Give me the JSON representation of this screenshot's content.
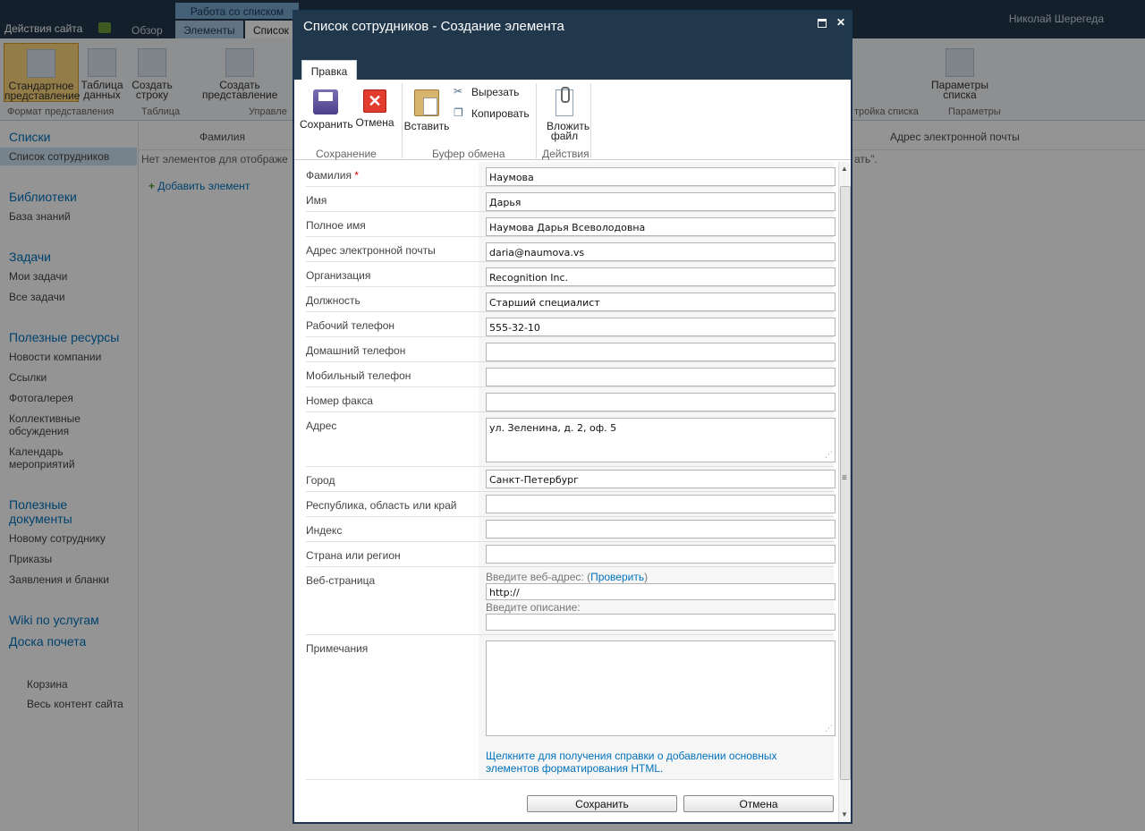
{
  "background": {
    "site_actions": "Действия сайта",
    "tab_overview": "Обзор",
    "context_header": "Работа со списком",
    "tab_elements": "Элементы",
    "tab_list": "Список",
    "user_name": "Николай Шерегеда",
    "ribbon": {
      "standard_view": "Стандартное представление",
      "datasheet": "Таблица данных",
      "create_row": "Создать строку",
      "create_view": "Создать представление",
      "list_params": "Параметры списка",
      "group_format": "Формат представления",
      "group_table": "Таблица",
      "group_manage": "Управле",
      "group_settings": "тройка списка",
      "group_params": "Параметры"
    },
    "nav": {
      "lists": "Списки",
      "employee_list": "Список сотрудников",
      "libraries": "Библиотеки",
      "knowledge_base": "База знаний",
      "tasks": "Задачи",
      "my_tasks": "Мои задачи",
      "all_tasks": "Все задачи",
      "resources": "Полезные ресурсы",
      "news": "Новости компании",
      "links": "Ссылки",
      "gallery": "Фотогалерея",
      "discussions": "Коллективные обсуждения",
      "calendar": "Календарь мероприятий",
      "documents": "Полезные документы",
      "newcomer": "Новому сотруднику",
      "orders": "Приказы",
      "forms": "Заявления и бланки",
      "wiki": "Wiki по услугам",
      "honor": "Доска почета",
      "recycle": "Корзина",
      "all_content": "Весь контент сайта"
    },
    "list_col_lastname": "Фамилия",
    "list_col_email": "Адрес электронной почты",
    "empty_text": "Нет элементов для отображе",
    "empty_tail": "ать\".",
    "add_item": "Добавить элемент"
  },
  "dialog": {
    "title": "Список сотрудников - Создание элемента",
    "tab_edit": "Правка",
    "buttons": {
      "save": "Сохранить",
      "cancel": "Отмена",
      "paste": "Вставить",
      "cut": "Вырезать",
      "copy": "Копировать",
      "attach": "Вложить файл"
    },
    "groups": {
      "save": "Сохранение",
      "clipboard": "Буфер обмена",
      "actions": "Действия"
    },
    "fields": [
      {
        "label": "Фамилия",
        "required": "*",
        "value": "Наумова"
      },
      {
        "label": "Имя",
        "value": "Дарья"
      },
      {
        "label": "Полное имя",
        "value": "Наумова Дарья Всеволодовна"
      },
      {
        "label": "Адрес электронной почты",
        "value": "daria@naumova.vs"
      },
      {
        "label": "Организация",
        "value": "Recognition Inc."
      },
      {
        "label": "Должность",
        "value": "Старший специалист"
      },
      {
        "label": "Рабочий телефон",
        "value": "555-32-10"
      },
      {
        "label": "Домашний телефон",
        "value": ""
      },
      {
        "label": "Мобильный телефон",
        "value": ""
      },
      {
        "label": "Номер факса",
        "value": ""
      },
      {
        "label": "Адрес",
        "value": "ул. Зеленина, д. 2, оф. 5"
      },
      {
        "label": "Город",
        "value": "Санкт-Петербург"
      },
      {
        "label": "Республика, область или край",
        "value": ""
      },
      {
        "label": "Индекс",
        "value": ""
      },
      {
        "label": "Страна или регион",
        "value": ""
      }
    ],
    "web": {
      "label": "Веб-страница",
      "hint_url_pre": "Введите веб-адрес: (",
      "hint_url_link": "Проверить",
      "hint_url_post": ")",
      "url_value": "http://",
      "hint_desc": "Введите описание:",
      "desc_value": ""
    },
    "notes": {
      "label": "Примечания",
      "value": "",
      "help": "Щелкните для получения справки о добавлении основных элементов форматирования HTML."
    },
    "footer": {
      "save": "Сохранить",
      "cancel": "Отмена"
    }
  }
}
